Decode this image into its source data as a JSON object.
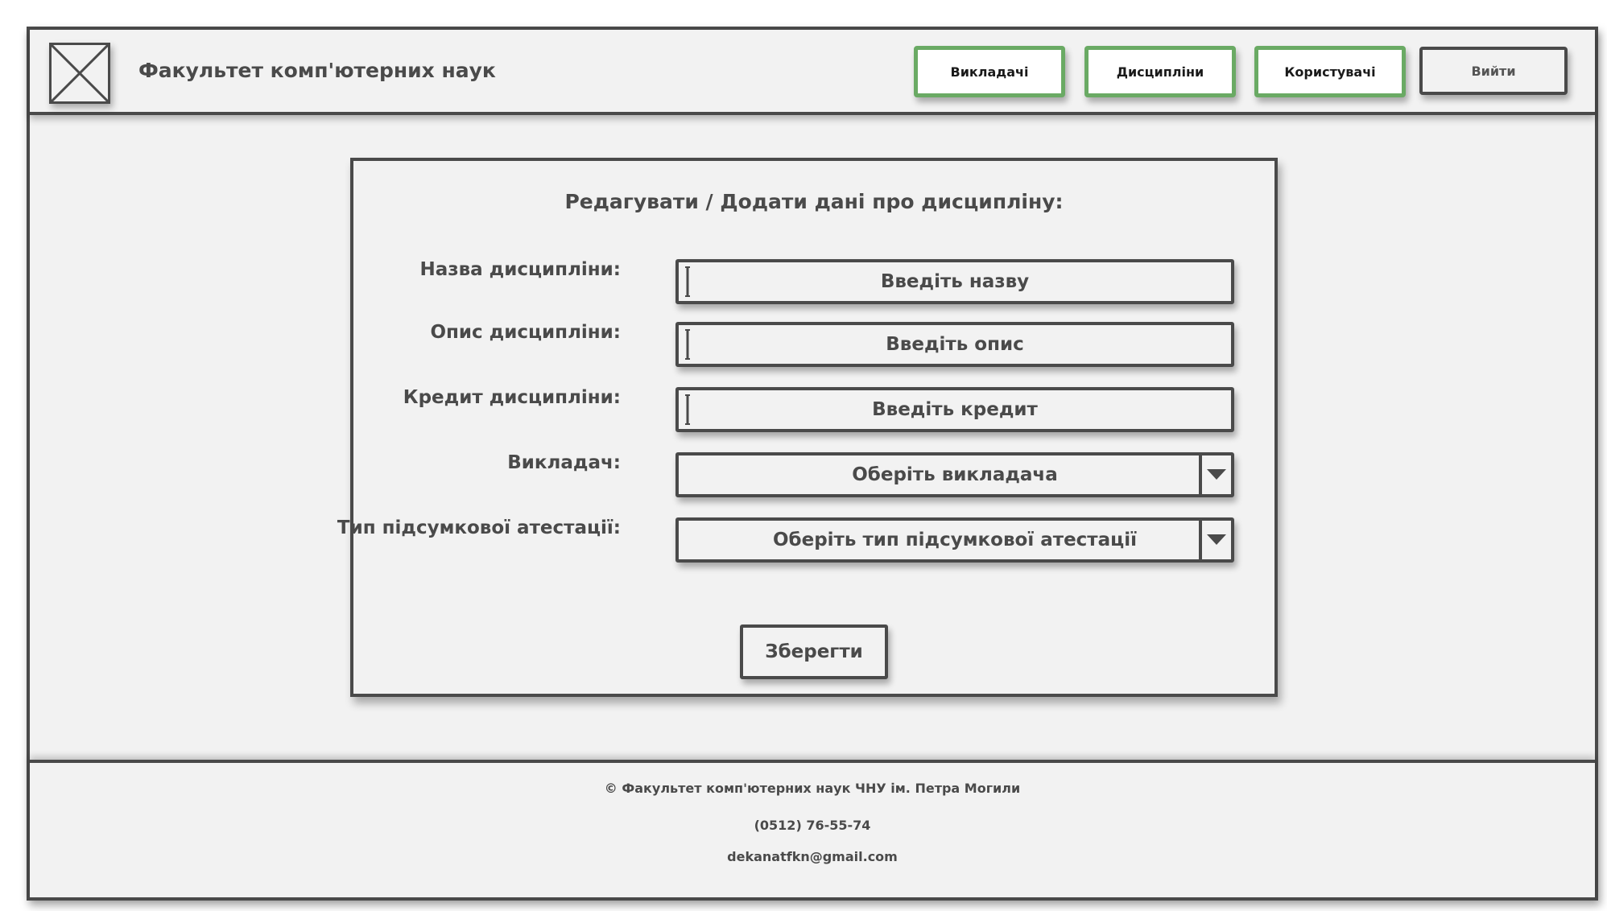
{
  "header": {
    "title": "Факультет комп'ютерних наук",
    "logo_icon": "image-placeholder-icon",
    "nav": [
      {
        "label": "Викладачі"
      },
      {
        "label": "Дисципліни"
      },
      {
        "label": "Користувачі"
      }
    ],
    "logout_label": "Вийти",
    "accent_color": "#6aaa64"
  },
  "form": {
    "title": "Редагувати / Додати дані про дисципліну:",
    "fields": [
      {
        "label": "Назва дисципліни:",
        "placeholder": "Введіть назву"
      },
      {
        "label": "Опис дисципліни:",
        "placeholder": "Введіть опис"
      },
      {
        "label": "Кредит дисципліни:",
        "placeholder": "Введіть кредит"
      }
    ],
    "selects": [
      {
        "label": "Викладач:",
        "value": "Оберіть викладача"
      },
      {
        "label": "Тип підсумкової атестації:",
        "value": "Оберіть тип підсумкової атестації"
      }
    ],
    "save_label": "Зберегти"
  },
  "footer": {
    "copyright": "© Факультет комп'ютерних наук ЧНУ ім. Петра Могили",
    "phone": "(0512) 76-55-74",
    "email": "dekanatfkn@gmail.com"
  }
}
